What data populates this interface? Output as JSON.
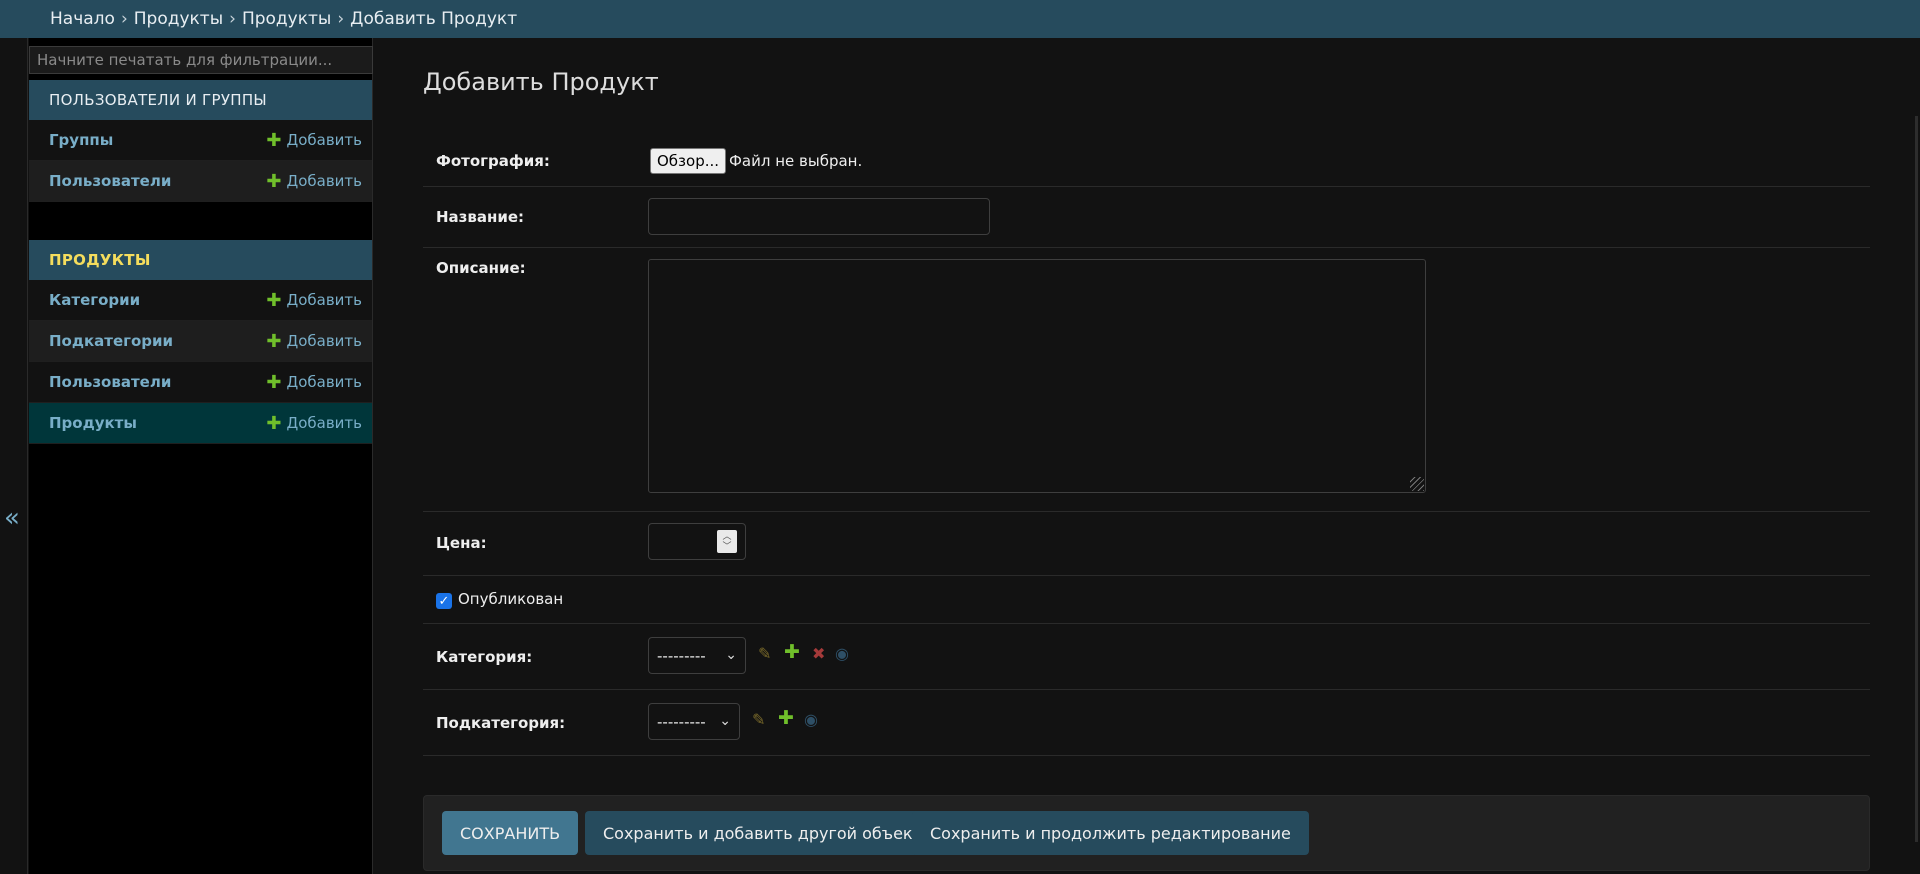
{
  "breadcrumbs": {
    "items": [
      "Начало",
      "Продукты",
      "Продукты",
      "Добавить Продукт"
    ],
    "separator": "›"
  },
  "nav_toggle": {
    "glyph": "«"
  },
  "sidebar": {
    "filter_placeholder": "Начните печатать для фильтрации...",
    "modules": [
      {
        "caption": "ПОЛЬЗОВАТЕЛИ И ГРУППЫ",
        "rows": [
          {
            "label": "Группы",
            "add": "Добавить"
          },
          {
            "label": "Пользователи",
            "add": "Добавить"
          }
        ]
      },
      {
        "caption": "ПРОДУКТЫ",
        "rows": [
          {
            "label": "Категории",
            "add": "Добавить"
          },
          {
            "label": "Подкатегории",
            "add": "Добавить"
          },
          {
            "label": "Пользователи",
            "add": "Добавить"
          },
          {
            "label": "Продукты",
            "add": "Добавить"
          }
        ]
      }
    ]
  },
  "main": {
    "title": "Добавить Продукт",
    "fields": {
      "photo": {
        "label": "Фотография:",
        "button": "Обзор...",
        "status": "Файл не выбран."
      },
      "name": {
        "label": "Название:",
        "value": ""
      },
      "description": {
        "label": "Описание:",
        "value": ""
      },
      "price": {
        "label": "Цена:",
        "value": ""
      },
      "published": {
        "label": "Опубликован",
        "checked": true
      },
      "category": {
        "label": "Категория:",
        "selected": "---------"
      },
      "subcategory": {
        "label": "Подкатегория:",
        "selected": "---------"
      }
    },
    "buttons": {
      "save": "СОХРАНИТЬ",
      "save_add_another": "Сохранить и добавить другой объект",
      "save_continue": "Сохранить и продолжить редактирование"
    }
  },
  "colors": {
    "header_bg": "#264b5d",
    "link": "#79aec8",
    "add_plus": "#70bf2b",
    "active_row": "#00363a",
    "primary_button": "#417690",
    "background": "#121212"
  },
  "icons": {
    "collapse": "double-chevron-left-icon",
    "add": "plus-icon",
    "edit": "pencil-icon",
    "delete": "x-icon",
    "view": "eye-icon"
  }
}
